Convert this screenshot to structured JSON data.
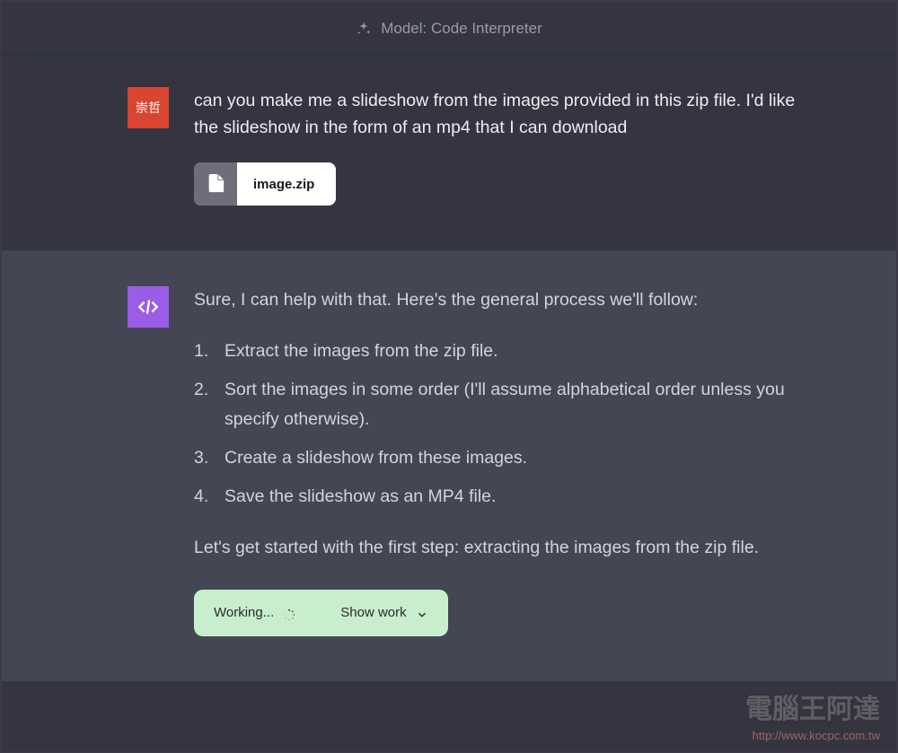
{
  "header": {
    "model_label": "Model: Code Interpreter"
  },
  "user": {
    "avatar_text": "崇哲",
    "message": "can you make me a slideshow from the images provided in this zip file. I'd like the slideshow in the form of an mp4 that I can download",
    "file": {
      "name": "image.zip"
    }
  },
  "assistant": {
    "intro": "Sure, I can help with that. Here's the general process we'll follow:",
    "steps": [
      "Extract the images from the zip file.",
      "Sort the images in some order (I'll assume alphabetical order unless you specify otherwise).",
      "Create a slideshow from these images.",
      "Save the slideshow as an MP4 file."
    ],
    "outro": "Let's get started with the first step: extracting the images from the zip file.",
    "status": {
      "working_label": "Working...",
      "show_work_label": "Show work"
    }
  },
  "watermark": {
    "text": "電腦王阿達",
    "url": "http://www.kocpc.com.tw"
  }
}
